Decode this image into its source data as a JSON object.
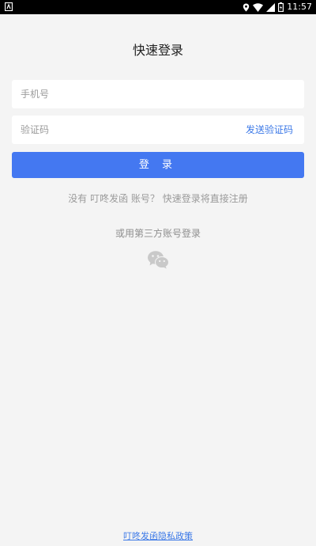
{
  "status_bar": {
    "time": "11:57",
    "icons": [
      "app-notification-icon",
      "location-icon",
      "wifi-icon",
      "signal-icon",
      "battery-icon"
    ]
  },
  "page": {
    "title": "快速登录"
  },
  "form": {
    "phone_placeholder": "手机号",
    "code_placeholder": "验证码",
    "send_code_label": "发送验证码",
    "login_label": "登 录"
  },
  "hint": "没有 叮咚发函 账号？ 快速登录将直接注册",
  "third_party": {
    "label": "或用第三方账号登录",
    "icons": [
      "wechat-icon"
    ]
  },
  "footer": {
    "privacy_link": "叮咚发函隐私政策"
  },
  "colors": {
    "accent": "#4478f1",
    "link": "#3b78e7",
    "background": "#f4f4f4"
  }
}
